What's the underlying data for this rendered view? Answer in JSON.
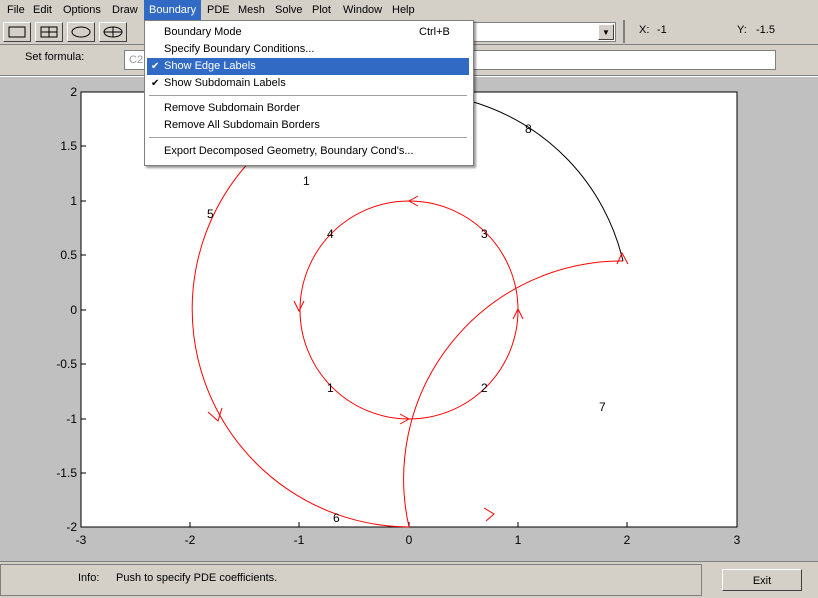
{
  "menubar": {
    "items": [
      {
        "label": "File"
      },
      {
        "label": "Edit"
      },
      {
        "label": "Options"
      },
      {
        "label": "Draw"
      },
      {
        "label": "Boundary"
      },
      {
        "label": "PDE"
      },
      {
        "label": "Mesh"
      },
      {
        "label": "Solve"
      },
      {
        "label": "Plot"
      },
      {
        "label": "Window"
      },
      {
        "label": "Help"
      }
    ]
  },
  "toolbar": {
    "buttons": [
      {
        "icon": "rectangle-icon"
      },
      {
        "icon": "centered-rectangle-icon"
      },
      {
        "icon": "ellipse-icon"
      },
      {
        "icon": "centered-ellipse-icon"
      }
    ],
    "coords": {
      "x_label": "X:",
      "x_value": "-1",
      "y_label": "Y:",
      "y_value": "-1.5"
    }
  },
  "formula": {
    "label": "Set formula:",
    "value": "C2"
  },
  "boundary_menu": {
    "items": [
      {
        "label": "Boundary Mode",
        "shortcut": "Ctrl+B",
        "checked": false
      },
      {
        "label": "Specify Boundary Conditions...",
        "checked": false
      },
      {
        "label": "Show Edge Labels",
        "checked": true
      },
      {
        "label": "Show Subdomain Labels",
        "checked": true
      },
      {
        "label": "Remove Subdomain Border",
        "checked": false
      },
      {
        "label": "Remove All Subdomain Borders",
        "checked": false
      },
      {
        "label": "Export Decomposed Geometry, Boundary Cond's...",
        "checked": false
      }
    ],
    "check_glyph": "✔"
  },
  "axes": {
    "x_ticks": [
      "-3",
      "-2",
      "-1",
      "0",
      "1",
      "2",
      "3"
    ],
    "y_ticks": [
      "2",
      "1.5",
      "1",
      "0.5",
      "0",
      "-0.5",
      "-1",
      "-1.5",
      "-2"
    ],
    "edge_color": "#ff0000",
    "boundary_color": "#000000",
    "edge_labels": [
      "1",
      "2",
      "3",
      "4",
      "5",
      "6",
      "7",
      "8"
    ],
    "subdomain_label": "1"
  },
  "status": {
    "info_label": "Info:",
    "info_text": "Push to specify PDE coefficients.",
    "exit_label": "Exit"
  }
}
